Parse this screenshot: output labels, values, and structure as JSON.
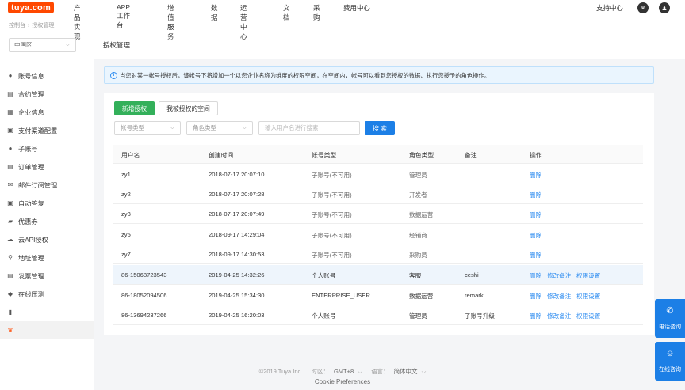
{
  "header": {
    "logo": "tuya.com",
    "nav": [
      "产品实现",
      "APP工作台",
      "增值服务",
      "数据",
      "运营中心",
      "文档",
      "采购",
      "费用中心"
    ],
    "support": "支持中心"
  },
  "breadcrumb": [
    "控制台",
    "授权管理"
  ],
  "region": "中国区",
  "page_title": "授权管理",
  "sidebar": {
    "items": [
      {
        "label": "账号信息",
        "icon": "user-icon"
      },
      {
        "label": "合约管理",
        "icon": "contract-icon"
      },
      {
        "label": "企业信息",
        "icon": "company-icon"
      },
      {
        "label": "支付渠道配置",
        "icon": "payment-icon"
      },
      {
        "label": "子账号",
        "icon": "sub-account-icon"
      },
      {
        "label": "订单管理",
        "icon": "order-icon"
      },
      {
        "label": "邮件订阅管理",
        "icon": "mail-icon"
      },
      {
        "label": "自动答复",
        "icon": "auto-reply-icon"
      },
      {
        "label": "优惠券",
        "icon": "coupon-icon"
      },
      {
        "label": "云API授权",
        "icon": "cloud-icon"
      },
      {
        "label": "地址管理",
        "icon": "location-icon"
      },
      {
        "label": "发票管理",
        "icon": "invoice-icon"
      },
      {
        "label": "在线压测",
        "icon": "stress-test-icon"
      },
      {
        "label": "",
        "icon": "clipboard-icon"
      },
      {
        "label": "",
        "icon": "authorization-icon"
      }
    ]
  },
  "notice": "当您对某一帐号授权后，该帐号下将增加一个以您企业名称为维度的权限空间，在空间内，帐号可以看到您授权的数据、执行您授予的角色操作。",
  "toolbar": {
    "add_label": "新增授权",
    "granted_label": "我被授权的空间",
    "account_type_placeholder": "帐号类型",
    "role_type_placeholder": "角色类型",
    "search_placeholder": "输入用户名进行搜索",
    "search_label": "搜 索"
  },
  "table": {
    "headers": [
      "用户名",
      "创建时间",
      "帐号类型",
      "角色类型",
      "备注",
      "操作"
    ],
    "rows": [
      {
        "user": "zy1",
        "time": "2018-07-17 20:07:10",
        "account": "子账号(不可用)",
        "role": "管理员",
        "note": "",
        "ops": [
          "删除"
        ]
      },
      {
        "user": "zy2",
        "time": "2018-07-17 20:07:28",
        "account": "子账号(不可用)",
        "role": "开发者",
        "note": "",
        "ops": [
          "删除"
        ]
      },
      {
        "user": "zy3",
        "time": "2018-07-17 20:07:49",
        "account": "子账号(不可用)",
        "role": "数据运营",
        "note": "",
        "ops": [
          "删除"
        ]
      },
      {
        "user": "zy5",
        "time": "2018-09-17 14:29:04",
        "account": "子账号(不可用)",
        "role": "经销商",
        "note": "",
        "ops": [
          "删除"
        ]
      },
      {
        "user": "zy7",
        "time": "2018-09-17 14:30:53",
        "account": "子账号(不可用)",
        "role": "采购员",
        "note": "",
        "ops": [
          "删除"
        ]
      },
      {
        "user": "86-15068723543",
        "time": "2019-04-25 14:32:26",
        "account": "个人账号",
        "role": "客服",
        "note": "ceshi",
        "ops": [
          "删除",
          "修改备注",
          "权限设置"
        ]
      },
      {
        "user": "86-18052094506",
        "time": "2019-04-25 15:34:30",
        "account": "ENTERPRISE_USER",
        "role": "数据运营",
        "note": "remark",
        "ops": [
          "删除",
          "修改备注",
          "权限设置"
        ]
      },
      {
        "user": "86-13694237266",
        "time": "2019-04-25 16:20:03",
        "account": "个人账号",
        "role": "管理员",
        "note": "子账号升级",
        "ops": [
          "删除",
          "修改备注",
          "权限设置"
        ]
      }
    ]
  },
  "footer": {
    "copyright": "©2019 Tuya Inc.",
    "timezone_label": "时区：",
    "timezone": "GMT+8",
    "language_label": "语言：",
    "language": "简体中文",
    "cookie": "Cookie Preferences"
  },
  "float": {
    "phone_label": "电话咨询",
    "online_label": "在线咨询"
  }
}
